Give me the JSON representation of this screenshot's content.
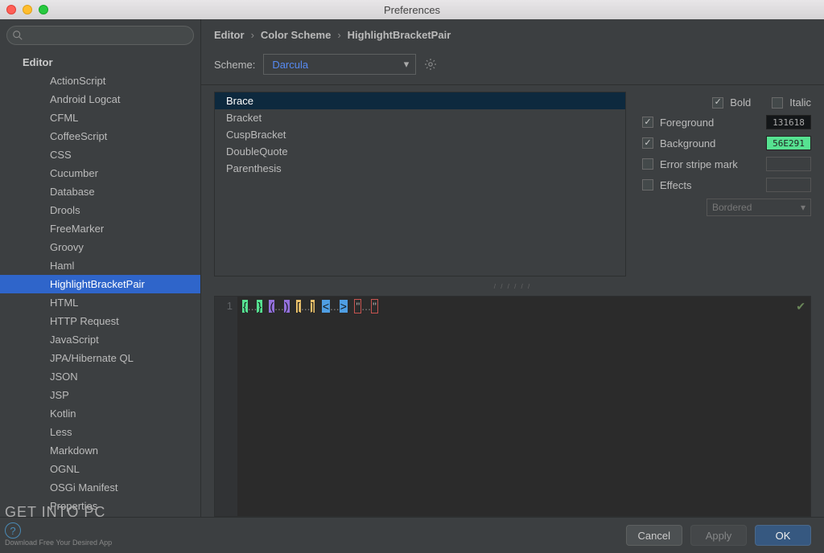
{
  "window": {
    "title": "Preferences"
  },
  "search": {
    "placeholder": ""
  },
  "sidebar": {
    "root": "Editor",
    "items": [
      "ActionScript",
      "Android Logcat",
      "CFML",
      "CoffeeScript",
      "CSS",
      "Cucumber",
      "Database",
      "Drools",
      "FreeMarker",
      "Groovy",
      "Haml",
      "HighlightBracketPair",
      "HTML",
      "HTTP Request",
      "JavaScript",
      "JPA/Hibernate QL",
      "JSON",
      "JSP",
      "Kotlin",
      "Less",
      "Markdown",
      "OGNL",
      "OSGi Manifest",
      "Properties"
    ],
    "selected_index": 11
  },
  "breadcrumb": {
    "a": "Editor",
    "b": "Color Scheme",
    "c": "HighlightBracketPair"
  },
  "scheme": {
    "label": "Scheme:",
    "value": "Darcula"
  },
  "bracket_list": {
    "items": [
      "Brace",
      "Bracket",
      "CuspBracket",
      "DoubleQuote",
      "Parenthesis"
    ],
    "selected_index": 0
  },
  "attrs": {
    "bold": {
      "label": "Bold",
      "checked": true
    },
    "italic": {
      "label": "Italic",
      "checked": false
    },
    "foreground": {
      "label": "Foreground",
      "checked": true,
      "color": "131618"
    },
    "background": {
      "label": "Background",
      "checked": true,
      "color": "56E291"
    },
    "error_stripe": {
      "label": "Error stripe mark",
      "checked": false
    },
    "effects": {
      "label": "Effects",
      "checked": false,
      "type": "Bordered"
    }
  },
  "preview": {
    "line_no": "1"
  },
  "footer": {
    "cancel": "Cancel",
    "apply": "Apply",
    "ok": "OK"
  },
  "watermark": {
    "title": "GET INTO PC",
    "sub": "Download Free Your Desired App"
  }
}
